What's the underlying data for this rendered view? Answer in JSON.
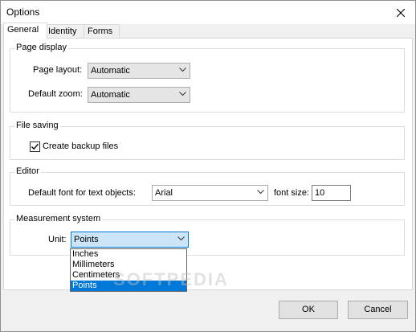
{
  "window": {
    "title": "Options"
  },
  "tabs": [
    {
      "label": "General",
      "active": true
    },
    {
      "label": "Identity",
      "active": false
    },
    {
      "label": "Forms",
      "active": false
    }
  ],
  "page_display": {
    "title": "Page display",
    "page_layout_label": "Page layout:",
    "page_layout_value": "Automatic",
    "default_zoom_label": "Default zoom:",
    "default_zoom_value": "Automatic"
  },
  "file_saving": {
    "title": "File saving",
    "backup_label": "Create backup files",
    "backup_checked": true
  },
  "editor": {
    "title": "Editor",
    "font_label": "Default font for text objects:",
    "font_value": "Arial",
    "font_size_label": "font size:",
    "font_size_value": "10"
  },
  "measurement": {
    "title": "Measurement system",
    "unit_label": "Unit:",
    "unit_value": "Points",
    "options": [
      "Inches",
      "Millimeters",
      "Centimeters",
      "Points"
    ],
    "selected_option": "Points"
  },
  "watermark": "SOFTPEDIA",
  "buttons": {
    "ok": "OK",
    "cancel": "Cancel"
  },
  "colors": {
    "accent": "#0078d7",
    "selection_bg": "#0078d7",
    "open_combo_bg": "#cce4f7"
  },
  "icons": {
    "close": "close-icon",
    "chevron": "chevron-down-icon",
    "check": "checkmark-icon"
  }
}
